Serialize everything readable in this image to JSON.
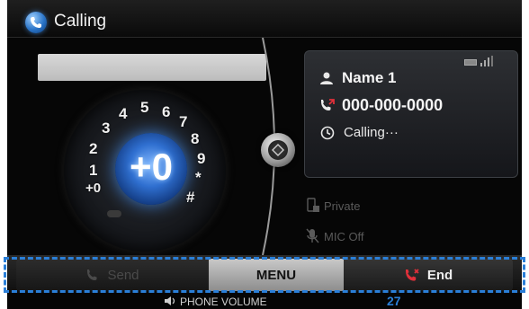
{
  "header": {
    "title": "Calling"
  },
  "dial": {
    "center_value": "+0",
    "keys": [
      "+0",
      "1",
      "2",
      "3",
      "4",
      "5",
      "6",
      "7",
      "8",
      "9",
      "*",
      "#"
    ]
  },
  "call_info": {
    "name": "Name 1",
    "phone_number": "000-000-0000",
    "status": "Calling···"
  },
  "options": {
    "private": "Private",
    "mic_off": "MIC Off"
  },
  "bottom_bar": {
    "send": "Send",
    "menu": "MENU",
    "end": "End"
  },
  "volume": {
    "label": "PHONE VOLUME",
    "value": "27"
  },
  "colors": {
    "accent_blue": "#2a7fd8",
    "end_red": "#e0303a"
  }
}
